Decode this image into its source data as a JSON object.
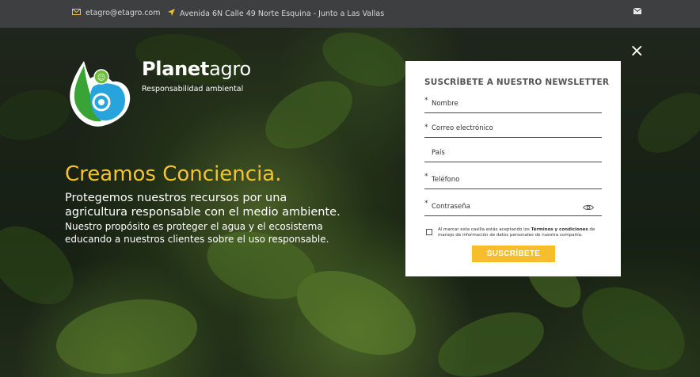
{
  "topbar": {
    "email": "etagro@etagro.com",
    "address": "Avenida 6N Calle 49 Norte Esquina - Junto a Las Vallas",
    "email_icon": "envelope-icon",
    "location_icon": "location-arrow-icon",
    "mail_icon_right": "envelope-icon"
  },
  "brand": {
    "name_bold": "Planet",
    "name_rest": "agro",
    "tagline": "Responsabilidad ambiental"
  },
  "hero": {
    "headline": "Creamos Conciencia.",
    "sub1": "Protegemos nuestros recursos por una agricultura responsable con el medio ambiente.",
    "sub2": "Nuestro propósito es proteger el agua y el ecosistema educando a nuestros clientes sobre el uso responsable."
  },
  "newsletter": {
    "title": "SUSCRÍBETE A NUESTRO NEWSLETTER",
    "close": "×",
    "fields": {
      "nombre": "Nombre",
      "correo": "Correo electrónico",
      "pais": "País",
      "telefono": "Teléfono",
      "contrasena": "Contraseña"
    },
    "required_mark": "*",
    "consent_pre": "Al marcar esta casilla estás aceptando los ",
    "consent_bold": "Términos y condiciones",
    "consent_post": " de manejo de información de datos personales de nuestra compañía.",
    "button": "SUSCRÍBETE"
  },
  "colors": {
    "accent": "#f6be2c",
    "topbar": "#3e3f40"
  }
}
